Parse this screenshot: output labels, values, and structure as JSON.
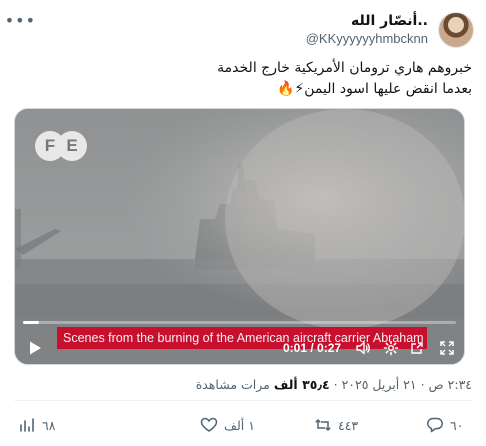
{
  "author": {
    "display_name": "..أنصّار الله",
    "handle": "@KKyyyyyyhmbcknn"
  },
  "tweet": {
    "line1": "خبروهم هاري ترومان الأمريكية خارج الخدمة",
    "line2": "بعدما انقض عليها اسود اليمن⚡🔥"
  },
  "video": {
    "logo_text": [
      "F",
      "E"
    ],
    "subtitle": "Scenes from the burning of the American aircraft carrier Abraham",
    "time": "0:01 / 0:27",
    "progress": 0.037
  },
  "meta": {
    "time": "٢:٣٤ ص",
    "date": "٢١ أبريل ٢٠٢٥",
    "views_count": "٣٥٫٤ ألف",
    "views_label": "مرات مشاهدة"
  },
  "actions": {
    "replies": "٦٠",
    "reposts": "٤٤٣",
    "likes": "١ ألف",
    "bookmarks": "٦٨"
  },
  "colors": {
    "subtitle_bg": "#c8102e",
    "text_primary": "#0f1419",
    "text_secondary": "#536471"
  }
}
